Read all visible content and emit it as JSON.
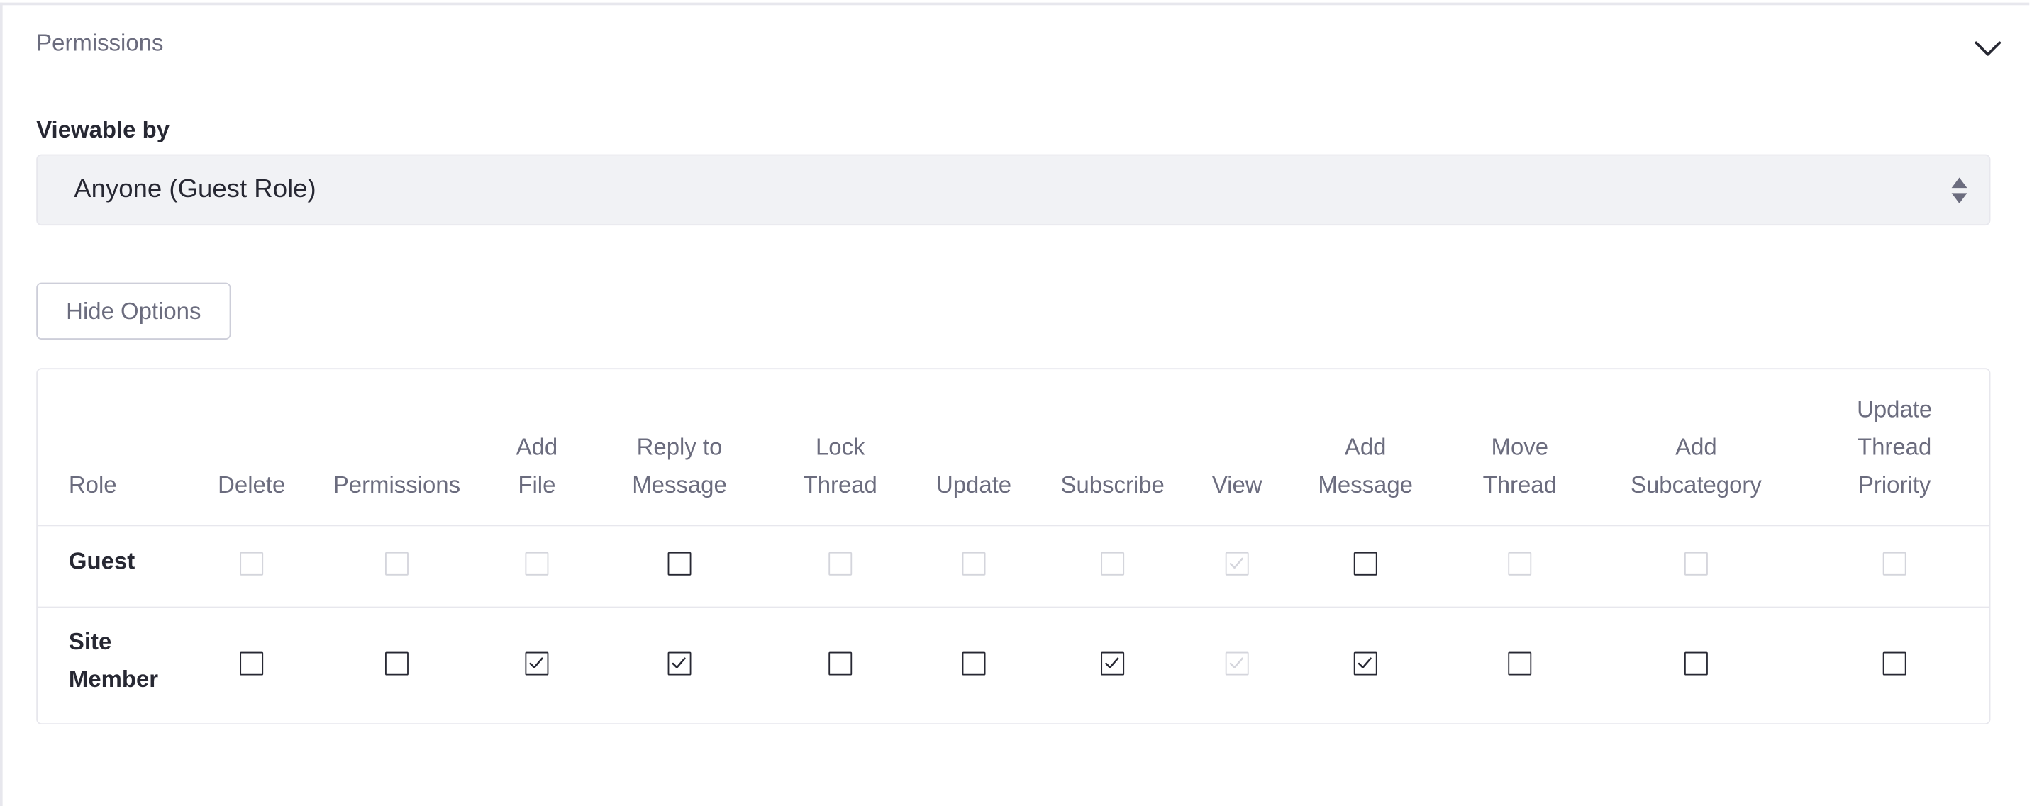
{
  "panel": {
    "title": "Permissions",
    "toggle_icon": "chevron-down-icon"
  },
  "viewable_by": {
    "label": "Viewable by",
    "selected": "Anyone (Guest Role)",
    "arrows_icon": "select-arrows-icon"
  },
  "hide_options": {
    "label": "Hide Options"
  },
  "table": {
    "role_header": "Role",
    "columns": [
      {
        "lines": [
          "Delete"
        ]
      },
      {
        "lines": [
          "Permissions"
        ]
      },
      {
        "lines": [
          "Add",
          "File"
        ]
      },
      {
        "lines": [
          "Reply to",
          "Message"
        ]
      },
      {
        "lines": [
          "Lock",
          "Thread"
        ]
      },
      {
        "lines": [
          "Update"
        ]
      },
      {
        "lines": [
          "Subscribe"
        ]
      },
      {
        "lines": [
          "View"
        ]
      },
      {
        "lines": [
          "Add",
          "Message"
        ]
      },
      {
        "lines": [
          "Move",
          "Thread"
        ]
      },
      {
        "lines": [
          "Add",
          "Subcategory"
        ]
      },
      {
        "lines": [
          "Update",
          "Thread",
          "Priority"
        ]
      }
    ],
    "rows": [
      {
        "role_lines": [
          "Guest"
        ],
        "cells": [
          {
            "checked": false,
            "disabled": true
          },
          {
            "checked": false,
            "disabled": true
          },
          {
            "checked": false,
            "disabled": true
          },
          {
            "checked": false,
            "disabled": false
          },
          {
            "checked": false,
            "disabled": true
          },
          {
            "checked": false,
            "disabled": true
          },
          {
            "checked": false,
            "disabled": true
          },
          {
            "checked": true,
            "disabled": true
          },
          {
            "checked": false,
            "disabled": false
          },
          {
            "checked": false,
            "disabled": true
          },
          {
            "checked": false,
            "disabled": true
          },
          {
            "checked": false,
            "disabled": true
          }
        ]
      },
      {
        "role_lines": [
          "Site",
          "Member"
        ],
        "cells": [
          {
            "checked": false,
            "disabled": false
          },
          {
            "checked": false,
            "disabled": false
          },
          {
            "checked": true,
            "disabled": false
          },
          {
            "checked": true,
            "disabled": false
          },
          {
            "checked": false,
            "disabled": false
          },
          {
            "checked": false,
            "disabled": false
          },
          {
            "checked": true,
            "disabled": false
          },
          {
            "checked": true,
            "disabled": true
          },
          {
            "checked": true,
            "disabled": false
          },
          {
            "checked": false,
            "disabled": false
          },
          {
            "checked": false,
            "disabled": false
          },
          {
            "checked": false,
            "disabled": false
          }
        ]
      }
    ]
  },
  "colors": {
    "text": "#272833",
    "muted": "#6b6c7e",
    "border": "#e7e7ed",
    "select_bg": "#f1f2f5",
    "disabled": "#d4d5dc"
  }
}
